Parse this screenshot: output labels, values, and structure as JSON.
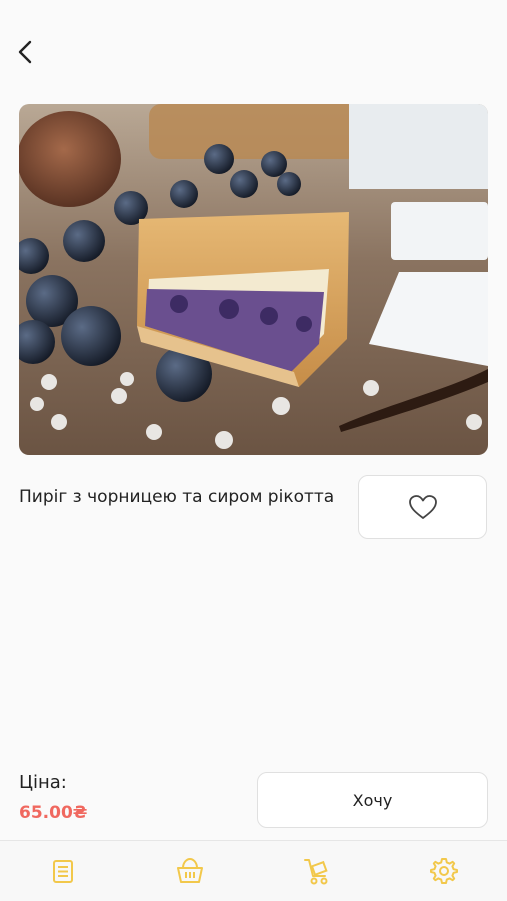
{
  "product": {
    "title": "Пиріг з чорницею та сиром рікотта",
    "price_label": "Ціна:",
    "price_value": "65.00₴",
    "want_button_label": "Хочу"
  },
  "colors": {
    "accent": "#f2c84b",
    "price": "#f0685f"
  },
  "icons": {
    "back": "chevron-left-icon",
    "favorite": "heart-icon",
    "tabs": [
      "menu-list-icon",
      "basket-icon",
      "delivery-cart-icon",
      "gear-icon"
    ]
  }
}
